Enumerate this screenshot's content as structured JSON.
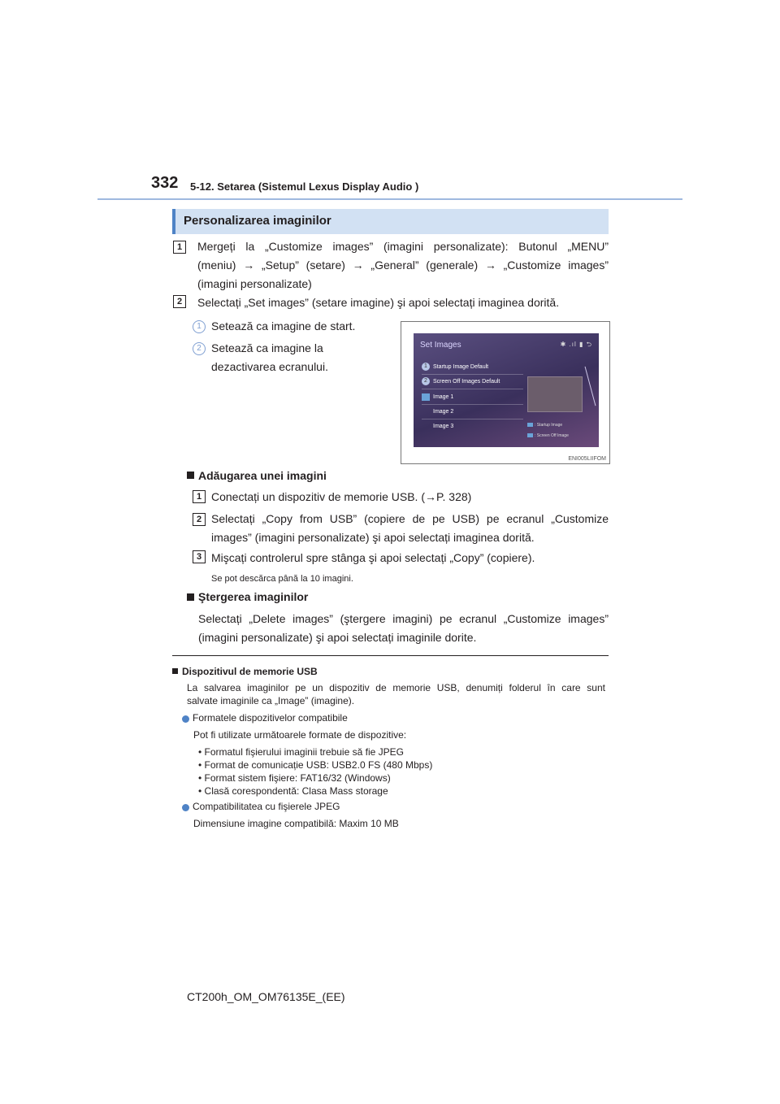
{
  "header": {
    "page_number": "332",
    "running_head": "5-12. Setarea (Sistemul Lexus Display Audio )"
  },
  "section": {
    "title": "Personalizarea imaginilor",
    "steps": [
      {
        "num": "1",
        "text_line1": "Mergeți la „Customize images” (imagini personalizate): Butonul „MENU”",
        "text_line2": "(meniu) → „Setup” (setare) → „General” (generale) → „Customize images”",
        "text_line3": "(imagini personalizate)"
      },
      {
        "num": "2",
        "text": "Selectați „Set images” (setare imagine) şi apoi selectați imaginea dorită."
      }
    ],
    "callouts": [
      {
        "num": "1",
        "text": "Setează ca imagine de start."
      },
      {
        "num": "2",
        "text_line1": "Setează ca imagine la",
        "text_line2": "dezactivarea ecranului."
      }
    ]
  },
  "figure": {
    "title": "Set Images",
    "status_icons": "✱ .ıl ▮ ⮌",
    "rows": [
      {
        "label": "Startup Image Default",
        "mark": "1"
      },
      {
        "label": "Screen Off Images Default",
        "mark": "2"
      },
      {
        "label": "Image 1",
        "mark": ""
      },
      {
        "label": "Image 2",
        "mark": ""
      },
      {
        "label": "Image 3",
        "mark": ""
      }
    ],
    "legend": [
      ": Startup Image",
      ": Screen Off Image"
    ],
    "code": "ENI005LIIFOM"
  },
  "add_images": {
    "heading": "Adăugarea unei imagini",
    "steps": [
      {
        "num": "1",
        "text": "Conectați un dispozitiv de memorie USB. (→P. 328)"
      },
      {
        "num": "2",
        "text_line1": "Selectați „Copy from USB” (copiere de pe USB) pe ecranul „Customize",
        "text_line2": "images” (imagini personalizate) şi apoi selectați imaginea dorită."
      },
      {
        "num": "3",
        "text": "Mişcați controlerul spre stânga şi apoi selectați „Copy” (copiere)."
      }
    ],
    "note": "Se pot descărca până la 10 imagini."
  },
  "delete_images": {
    "heading": "Ştergerea imaginilor",
    "text_line1": "Selectați „Delete images” (ştergere imagini) pe ecranul „Customize images”",
    "text_line2": "(imagini personalizate) şi apoi selectați imaginile dorite."
  },
  "notes": {
    "usb_heading": "Dispozitivul de memorie USB",
    "usb_line1": "La salvarea imaginilor pe un dispozitiv de memorie USB, denumiți folderul în care sunt",
    "usb_line2": "salvate imaginile ca „Image” (imagine).",
    "formats_heading": "Formatele dispozitivelor compatibile",
    "formats_intro": "Pot fi utilizate următoarele formate de dispozitive:",
    "formats_list": [
      "• Formatul fişierului imaginii trebuie să fie JPEG",
      "• Format de comunicație USB: USB2.0 FS (480 Mbps)",
      "• Format sistem fişiere: FAT16/32 (Windows)",
      "• Clasă corespondentă: Clasa Mass storage"
    ],
    "jpeg_heading": "Compatibilitatea cu fişierele JPEG",
    "jpeg_text": "Dimensiune imagine compatibilă: Maxim 10 MB"
  },
  "footer": "CT200h_OM_OM76135E_(EE)"
}
